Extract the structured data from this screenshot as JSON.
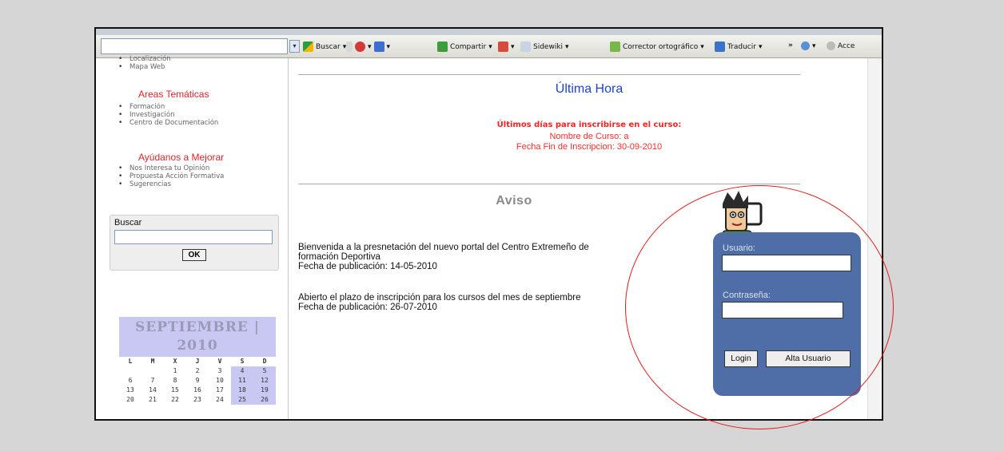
{
  "toolbar": {
    "search_label": "Buscar",
    "share_label": "Compartir",
    "sidewiki_label": "Sidewiki",
    "spellcheck_label": "Corrector ortográfico",
    "translate_label": "Traducir",
    "more_label": "»",
    "access_label": "Acce"
  },
  "sidebar": {
    "top_items": [
      "Localización",
      "Mapa Web"
    ],
    "areas_title": "Areas Temáticas",
    "areas_items": [
      "Formación",
      "Investigación",
      "Centro de Documentación"
    ],
    "mejorar_title": "Ayúdanos a Mejorar",
    "mejorar_items": [
      "Nos Interesa tu Opinión",
      "Propuesta Acción Formativa",
      "Sugerencias"
    ],
    "search_label": "Buscar",
    "search_button": "OK"
  },
  "calendar": {
    "title": "SEPTIEMBRE | 2010",
    "days": [
      "L",
      "M",
      "X",
      "J",
      "V",
      "S",
      "D"
    ],
    "rows": [
      [
        "",
        "",
        "1",
        "2",
        "3",
        "4",
        "5"
      ],
      [
        "6",
        "7",
        "8",
        "9",
        "10",
        "11",
        "12"
      ],
      [
        "13",
        "14",
        "15",
        "16",
        "17",
        "18",
        "19"
      ],
      [
        "20",
        "21",
        "22",
        "23",
        "24",
        "25",
        "26"
      ]
    ]
  },
  "main": {
    "ultima_title": "Última Hora",
    "notice_title": "Últimos días para inscribirse en el curso:",
    "notice_course": "Nombre de Curso: a",
    "notice_date": "Fecha Fin de Inscripcion:  30-09-2010",
    "aviso_title": "Aviso",
    "news1_line1": "Bienvenida a la presnetación del nuevo portal del Centro Extremeño de",
    "news1_line2": "formación Deportiva",
    "news1_date": "Fecha de publicación: 14-05-2010",
    "news2_line1": "Abierto el plazo de inscripción para los cursos del mes de septiembre",
    "news2_date": "Fecha de publicación: 26-07-2010"
  },
  "login": {
    "user_label": "Usuario:",
    "password_label": "Contraseña:",
    "login_button": "Login",
    "register_button": "Alta Usuario"
  },
  "colors": {
    "login_bg": "#4f6da6",
    "calendar_bg": "#c8c8f2",
    "highlight_circle": "#e31b1b",
    "headline_blue": "#1d3fd8",
    "notice_red": "#ff1f1f"
  }
}
